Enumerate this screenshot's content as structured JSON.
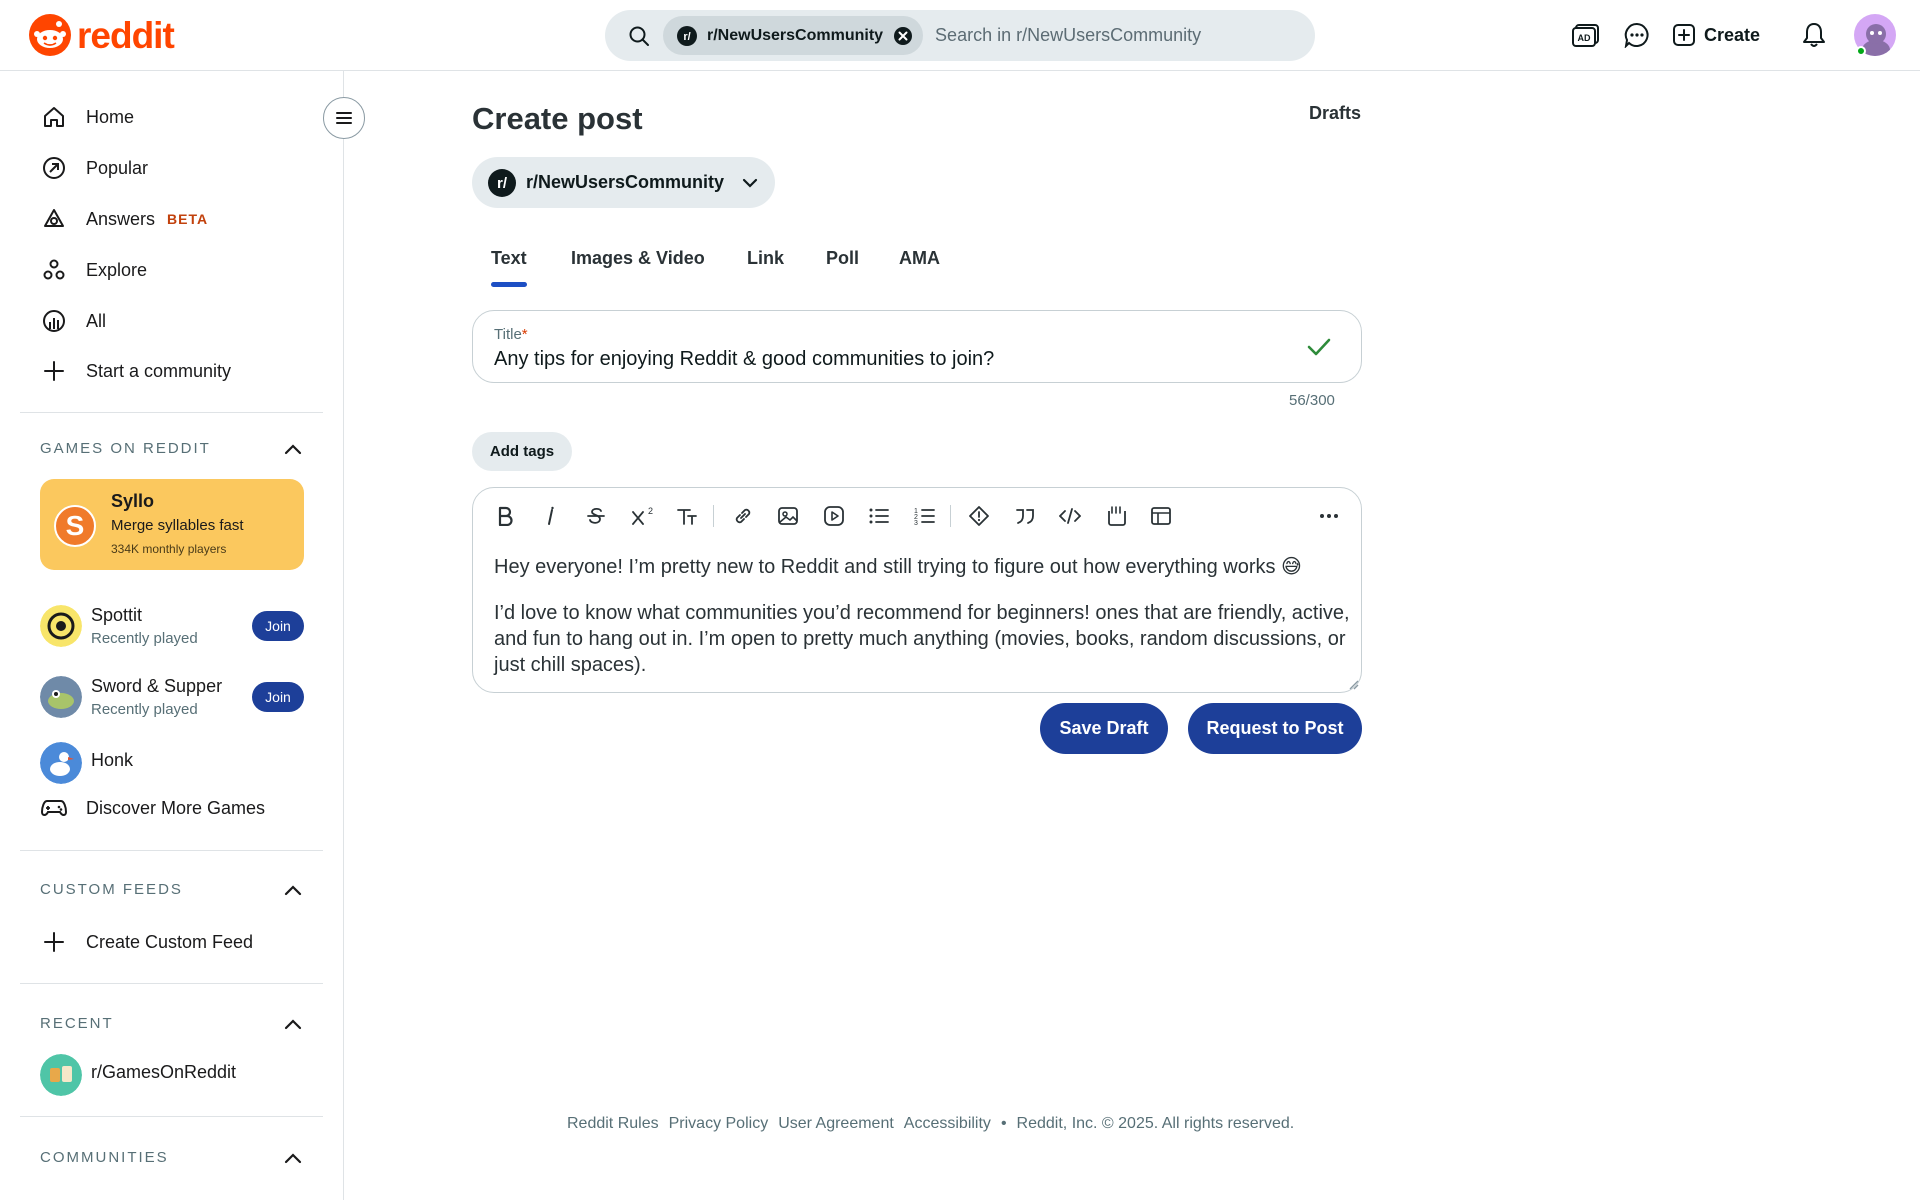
{
  "header": {
    "logo_text": "reddit",
    "search": {
      "chip_label": "r/NewUsersCommunity",
      "placeholder": "Search in r/NewUsersCommunity"
    },
    "icons": [
      "advertise-icon",
      "chat-icon",
      "create-icon",
      "notifications-icon",
      "avatar"
    ],
    "create_label": "Create"
  },
  "sidebar": {
    "nav": [
      {
        "label": "Home",
        "icon": "home-icon"
      },
      {
        "label": "Popular",
        "icon": "popular-icon"
      },
      {
        "label": "Answers",
        "icon": "answers-icon",
        "badge": "BETA"
      },
      {
        "label": "Explore",
        "icon": "explore-icon"
      },
      {
        "label": "All",
        "icon": "all-icon"
      },
      {
        "label": "Start a community",
        "icon": "plus-icon"
      }
    ],
    "games_section": {
      "title": "GAMES ON REDDIT",
      "featured": {
        "name": "Syllo",
        "description": "Merge syllables fast",
        "players": "334K monthly players",
        "logo_letter": "S"
      },
      "games": [
        {
          "name": "Spottit",
          "sub": "Recently played",
          "join": "Join"
        },
        {
          "name": "Sword & Supper",
          "sub": "Recently played",
          "join": "Join"
        },
        {
          "name": "Honk"
        }
      ],
      "discover": "Discover More Games"
    },
    "custom_feeds": {
      "title": "CUSTOM FEEDS",
      "create": "Create Custom Feed"
    },
    "recent": {
      "title": "RECENT",
      "items": [
        "r/GamesOnReddit"
      ]
    },
    "communities": {
      "title": "COMMUNITIES"
    }
  },
  "main": {
    "title": "Create post",
    "drafts_label": "Drafts",
    "community": "r/NewUsersCommunity",
    "tabs": [
      "Text",
      "Images & Video",
      "Link",
      "Poll",
      "AMA"
    ],
    "active_tab": "Text",
    "title_field": {
      "label": "Title",
      "required_mark": "*",
      "value": "Any tips for enjoying Reddit & good communities to join?",
      "count": "56/300"
    },
    "add_tags": "Add tags",
    "toolbar": [
      "bold-icon",
      "italic-icon",
      "strikethrough-icon",
      "superscript-icon",
      "heading-icon",
      "link-icon",
      "image-icon",
      "video-icon",
      "bullet-list-icon",
      "numbered-list-icon",
      "spoiler-icon",
      "quote-icon",
      "code-icon",
      "code-block-icon",
      "table-icon",
      "more-icon"
    ],
    "body": {
      "line1": "Hey everyone! I’m pretty new to Reddit and still trying to figure out how everything works 😅",
      "paragraph2": "I’d love to know what communities you’d recommend for beginners! ones that are friendly, active, and fun to hang out in. I’m open to pretty much anything (movies, books, random discussions, or just chill spaces)."
    },
    "save_draft": "Save Draft",
    "request_post": "Request to Post"
  },
  "footer": {
    "links": [
      "Reddit Rules",
      "Privacy Policy",
      "User Agreement",
      "Accessibility"
    ],
    "separator": "•",
    "copyright": "Reddit, Inc. © 2025. All rights reserved."
  },
  "colors": {
    "brand": "#ff4500",
    "primary_button": "#1d3f99",
    "active_tab": "#1d4fc4",
    "check": "#2e8b3a",
    "syllo_card": "#fbc85e"
  }
}
